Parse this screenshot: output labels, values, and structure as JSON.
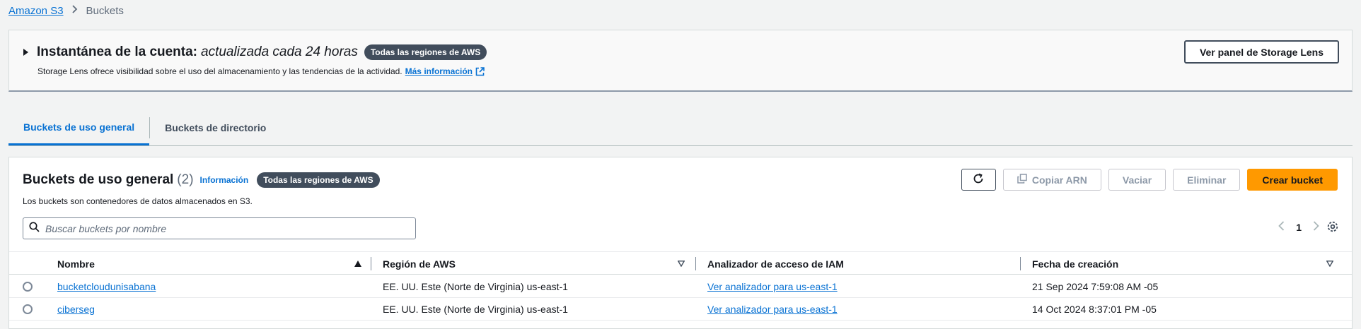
{
  "breadcrumb": {
    "root": "Amazon S3",
    "current": "Buckets"
  },
  "snapshot": {
    "title": "Instantánea de la cuenta:",
    "title_italic": "actualizada cada 24 horas",
    "badge": "Todas las regiones de AWS",
    "description": "Storage Lens ofrece visibilidad sobre el uso del almacenamiento y las tendencias de la actividad.",
    "more_link": "Más información",
    "button": "Ver panel de Storage Lens"
  },
  "tabs": [
    {
      "label": "Buckets de uso general",
      "active": true
    },
    {
      "label": "Buckets de directorio",
      "active": false
    }
  ],
  "panel": {
    "title": "Buckets de uso general",
    "count": "(2)",
    "info": "Información",
    "badge": "Todas las regiones de AWS",
    "description": "Los buckets son contenedores de datos almacenados en S3.",
    "actions": {
      "copy_arn": "Copiar ARN",
      "empty": "Vaciar",
      "delete": "Eliminar",
      "create": "Crear bucket"
    },
    "search_placeholder": "Buscar buckets por nombre",
    "page": "1"
  },
  "table": {
    "headers": {
      "name": "Nombre",
      "region": "Región de AWS",
      "iam": "Analizador de acceso de IAM",
      "created": "Fecha de creación"
    },
    "rows": [
      {
        "name": "bucketcloudunisabana",
        "region": "EE. UU. Este (Norte de Virginia) us-east-1",
        "iam": "Ver analizador para us-east-1",
        "created": "21 Sep 2024 7:59:08 AM -05"
      },
      {
        "name": "ciberseg",
        "region": "EE. UU. Este (Norte de Virginia) us-east-1",
        "iam": "Ver analizador para us-east-1",
        "created": "14 Oct 2024 8:37:01 PM -05"
      }
    ]
  },
  "colors": {
    "link": "#0972d3",
    "primary_button": "#ff9900",
    "badge_bg": "#414d5c"
  }
}
